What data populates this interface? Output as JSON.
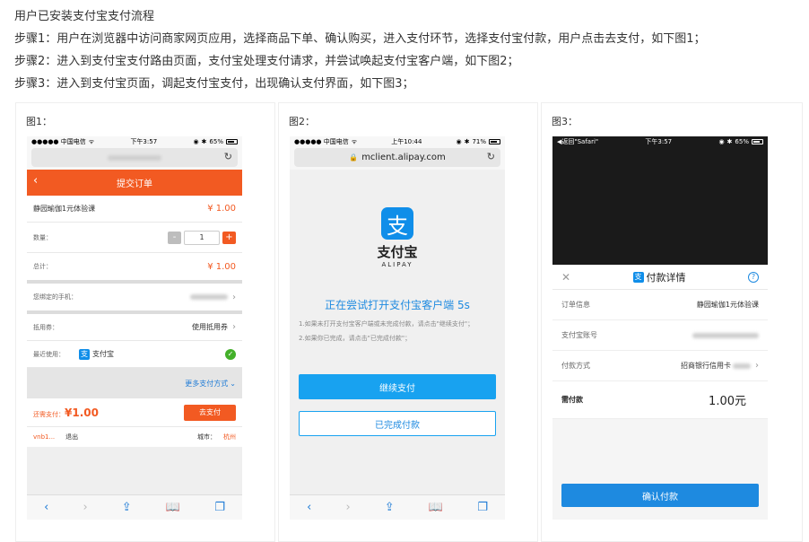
{
  "doc": {
    "title": "用户已安装支付宝支付流程",
    "step1": "步骤1：用户在浏览器中访问商家网页应用，选择商品下单、确认购买，进入支付环节，选择支付宝付款，用户点击去支付，如下图1；",
    "step2": "步骤2：进入到支付宝支付路由页面，支付宝处理支付请求，并尝试唤起支付宝客户端，如下图2；",
    "step3": "步骤3：进入到支付宝页面，调起支付宝支付，出现确认支付界面，如下图3；"
  },
  "fig1": {
    "caption": "图1：",
    "status": {
      "carrier": "●●●●● 中国电信",
      "time": "下午3:57",
      "battery": "65%"
    },
    "header": "提交订单",
    "product": "静园瑜伽1元体验课",
    "price": "¥ 1.00",
    "qty_label": "数量：",
    "minus": "-",
    "qty": "1",
    "plus": "+",
    "total_label": "总计：",
    "total": "¥ 1.00",
    "phone_label": "您绑定的手机：",
    "coupon_label": "抵用券：",
    "coupon_value": "使用抵用券",
    "recent_label": "最近使用：",
    "recent_icon": "支",
    "recent_method": "支付宝",
    "more_methods": "更多支付方式",
    "need_pay_label": "还需支付：",
    "need_pay": "¥1.00",
    "pay_button": "去支付",
    "user": "vnb1...",
    "logout": "退出",
    "city_label": "城市：",
    "city": "杭州"
  },
  "fig2": {
    "caption": "图2：",
    "status": {
      "carrier": "●●●●● 中国电信",
      "time": "上午10:44",
      "battery": "71%"
    },
    "url": "mclient.alipay.com",
    "logo_char": "支",
    "brand": "支付宝",
    "brand_en": "ALIPAY",
    "trying": "正在尝试打开支付宝客户端 5s",
    "tip1": "1.如果未打开支付宝客户端或未完成付款，请点击\"继续支付\"；",
    "tip2": "2.如果你已完成，请点击\"已完成付款\"；",
    "continue_button": "继续支付",
    "done_button": "已完成付款"
  },
  "fig3": {
    "caption": "图3：",
    "status": {
      "back": "◀返回\"Safari\"",
      "time": "下午3:57",
      "battery": "65%"
    },
    "sheet_title_icon": "支",
    "sheet_title": "付款详情",
    "help": "?",
    "order_label": "订单信息",
    "order_value": "静园瑜伽1元体验课",
    "account_label": "支付宝账号",
    "method_label": "付款方式",
    "method_value": "招商银行信用卡",
    "need_label": "需付款",
    "need_value": "1.00元",
    "confirm_button": "确认付款"
  },
  "colors": {
    "orange": "#f25a22",
    "alipay_blue": "#108ee9",
    "link_blue": "#1e8ae0"
  }
}
